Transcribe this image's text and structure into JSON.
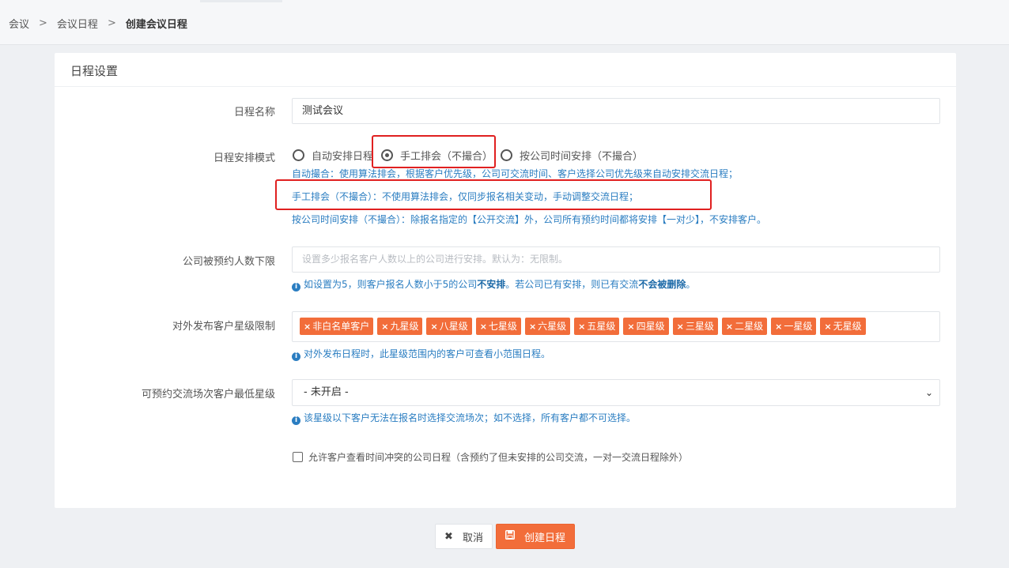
{
  "breadcrumb": {
    "items": [
      "会议",
      "会议日程"
    ],
    "current": "创建会议日程",
    "separator": ">"
  },
  "card": {
    "title": "日程设置"
  },
  "form": {
    "name": {
      "label": "日程名称",
      "value": "测试会议"
    },
    "mode": {
      "label": "日程安排模式",
      "options": [
        "自动安排日程",
        "手工排会（不撮合）",
        "按公司时间安排（不撮合）"
      ],
      "selected_index": 1,
      "help_lines": [
        "自动撮合：使用算法排会，根据客户优先级，公司可交流时间、客户选择公司优先级来自动安排交流日程；",
        "手工排会（不撮合）：不使用算法排会，仅同步报名相关变动，手动调整交流日程；",
        "按公司时间安排（不撮合）：除报名指定的【公开交流】外，公司所有预约时间都将安排【一对少】，不安排客户。"
      ]
    },
    "min_booking": {
      "label": "公司被预约人数下限",
      "placeholder": "设置多少报名客户人数以上的公司进行安排。默认为：无限制。",
      "help_prefix": "如设置为5，则客户报名人数小于5的公司",
      "help_bold1": "不安排",
      "help_middle": "。若公司已有安排，则已有交流",
      "help_bold2": "不会被删除",
      "help_suffix": "。"
    },
    "star_limit": {
      "label": "对外发布客户星级限制",
      "tags": [
        "非白名单客户",
        "九星级",
        "八星级",
        "七星级",
        "六星级",
        "五星级",
        "四星级",
        "三星级",
        "二星级",
        "一星级",
        "无星级"
      ],
      "help": "对外发布日程时，此星级范围内的客户可查看小范围日程。"
    },
    "min_star": {
      "label": "可预约交流场次客户最低星级",
      "selected": "- 未开启 -",
      "help": "该星级以下客户无法在报名时选择交流场次；如不选择，所有客户都不可选择。"
    },
    "allow_conflict": {
      "label": "允许客户查看时间冲突的公司日程（含预约了但未安排的公司交流，一对一交流日程除外）",
      "checked": false
    }
  },
  "actions": {
    "cancel_label": "取消",
    "create_label": "创建日程"
  },
  "colors": {
    "accent": "#f26d3a",
    "help_text": "#2a7dc1",
    "highlight_box": "#e02020"
  }
}
